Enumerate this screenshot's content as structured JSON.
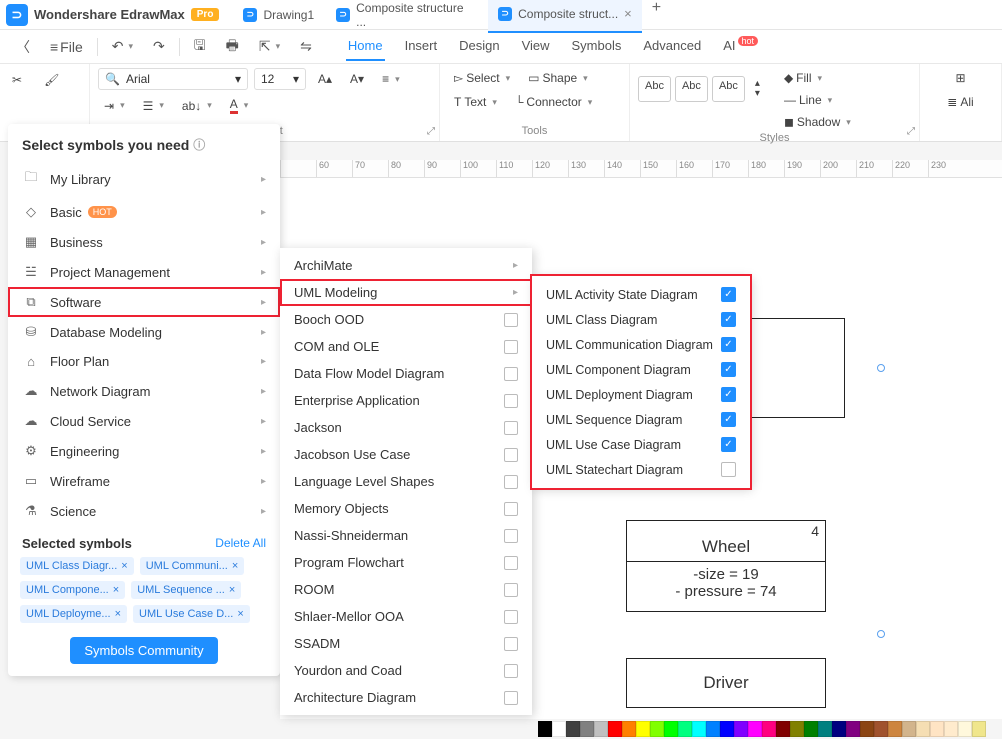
{
  "app": {
    "title": "Wondershare EdrawMax",
    "badge": "Pro"
  },
  "tabs": [
    {
      "label": "Drawing1",
      "active": false
    },
    {
      "label": "Composite structure ...",
      "active": false
    },
    {
      "label": "Composite struct...",
      "active": true
    }
  ],
  "menubar": {
    "file": "File"
  },
  "menus": [
    "Home",
    "Insert",
    "Design",
    "View",
    "Symbols",
    "Advanced",
    "AI"
  ],
  "active_menu": "Home",
  "ribbon": {
    "font_family": "Arial",
    "font_size": "12",
    "select_label": "Select",
    "shape_label": "Shape",
    "text_label": "Text",
    "connector_label": "Connector",
    "group_paragraph": "gnment",
    "group_tools": "Tools",
    "group_styles": "Styles",
    "fill": "Fill",
    "line": "Line",
    "shadow": "Shadow",
    "abc": "Abc",
    "align_label": "Ali"
  },
  "symbol_panel": {
    "header": "Select symbols you need",
    "items": [
      {
        "label": "My Library",
        "icon": "📁"
      },
      {
        "label": "Basic",
        "icon": "⬠",
        "hot": true
      },
      {
        "label": "Business",
        "icon": "▦"
      },
      {
        "label": "Project Management",
        "icon": "☱"
      },
      {
        "label": "Software",
        "icon": "⌑",
        "selected": true
      },
      {
        "label": "Database Modeling",
        "icon": "⛁"
      },
      {
        "label": "Floor Plan",
        "icon": "⌂"
      },
      {
        "label": "Network Diagram",
        "icon": "☁"
      },
      {
        "label": "Cloud Service",
        "icon": "☁"
      },
      {
        "label": "Engineering",
        "icon": "⚙"
      },
      {
        "label": "Wireframe",
        "icon": "▭"
      },
      {
        "label": "Science",
        "icon": "⚗"
      }
    ],
    "selected_header": "Selected symbols",
    "delete_all": "Delete All",
    "tags": [
      "UML Class Diagr...",
      "UML Communi...",
      "UML Compone...",
      "UML Sequence ...",
      "UML Deployme...",
      "UML Use Case D..."
    ],
    "community": "Symbols Community"
  },
  "submenu": {
    "items": [
      {
        "label": "ArchiMate",
        "arrow": true
      },
      {
        "label": "UML Modeling",
        "arrow": true,
        "selected": true
      },
      {
        "label": "Booch OOD"
      },
      {
        "label": "COM and OLE"
      },
      {
        "label": "Data Flow Model Diagram"
      },
      {
        "label": "Enterprise Application"
      },
      {
        "label": "Jackson"
      },
      {
        "label": "Jacobson Use Case"
      },
      {
        "label": "Language Level Shapes"
      },
      {
        "label": "Memory Objects"
      },
      {
        "label": "Nassi-Shneiderman"
      },
      {
        "label": "Program Flowchart"
      },
      {
        "label": "ROOM"
      },
      {
        "label": "Shlaer-Mellor OOA"
      },
      {
        "label": "SSADM"
      },
      {
        "label": "Yourdon and Coad"
      },
      {
        "label": "Architecture Diagram"
      }
    ]
  },
  "submenu3": {
    "items": [
      {
        "label": "UML Activity State Diagram",
        "checked": true
      },
      {
        "label": "UML Class Diagram",
        "checked": true
      },
      {
        "label": "UML Communication Diagram",
        "checked": true
      },
      {
        "label": "UML Component Diagram",
        "checked": true
      },
      {
        "label": "UML Deployment Diagram",
        "checked": true
      },
      {
        "label": "UML Sequence Diagram",
        "checked": true
      },
      {
        "label": "UML Use Case Diagram",
        "checked": true
      },
      {
        "label": "UML Statechart Diagram",
        "checked": false
      }
    ]
  },
  "ruler": [
    "",
    "60",
    "70",
    "80",
    "90",
    "100",
    "110",
    "120",
    "130",
    "140",
    "150",
    "160",
    "170",
    "180",
    "190",
    "200",
    "210",
    "220",
    "230"
  ],
  "diagram": {
    "wheel_title": "Wheel",
    "wheel_mult": "4",
    "wheel_l1": "-size = 19",
    "wheel_l2": "- pressure = 74",
    "driver_title": "Driver"
  },
  "colors": [
    "#000",
    "#fff",
    "#404040",
    "#808080",
    "#c0c0c0",
    "#ff0000",
    "#ff8000",
    "#ffff00",
    "#80ff00",
    "#00ff00",
    "#00ff80",
    "#00ffff",
    "#0080ff",
    "#0000ff",
    "#8000ff",
    "#ff00ff",
    "#ff0080",
    "#800000",
    "#808000",
    "#008000",
    "#008080",
    "#000080",
    "#800080",
    "#8b4513",
    "#a0522d",
    "#cd853f",
    "#d2b48c",
    "#f5deb3",
    "#ffe4c4",
    "#ffebcd",
    "#fff8dc",
    "#f0e68c"
  ]
}
